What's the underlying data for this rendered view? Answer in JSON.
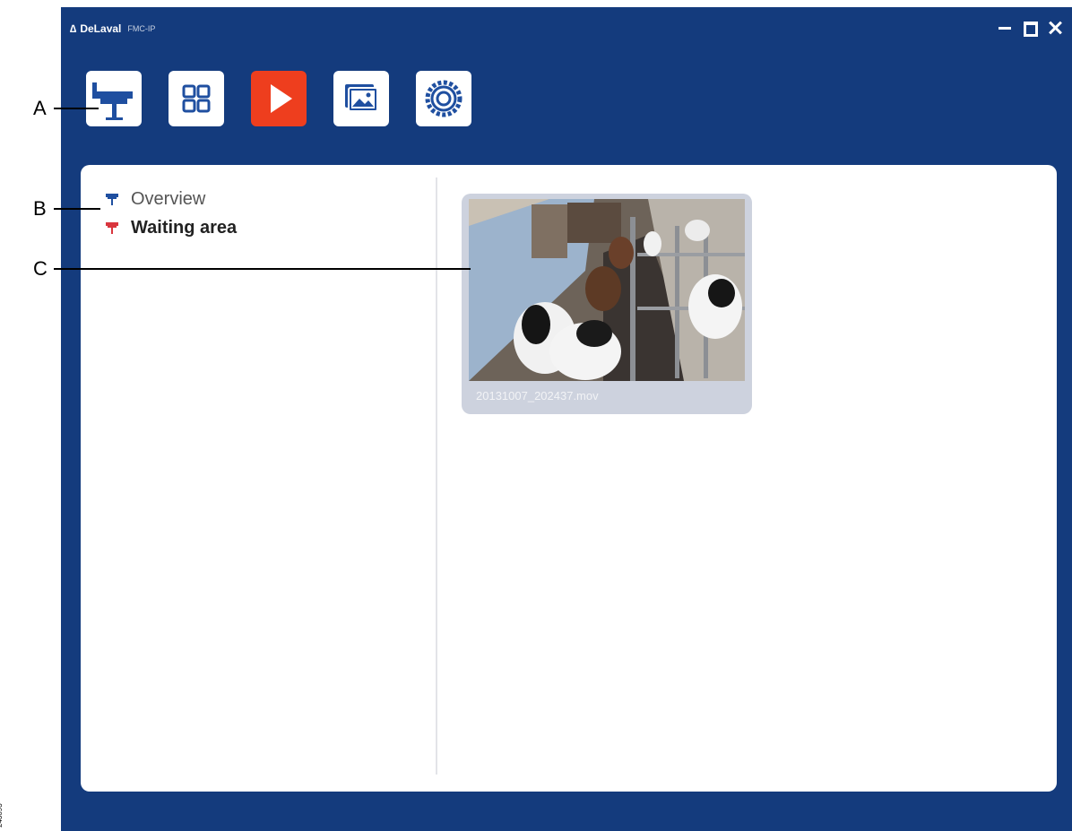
{
  "window": {
    "brand": "DeLaval",
    "product": "FMC-IP",
    "controls": [
      "minimize",
      "maximize",
      "close"
    ]
  },
  "toolbar": {
    "buttons": [
      {
        "icon": "camera-overview-icon",
        "active": false
      },
      {
        "icon": "grid-layout-icon",
        "active": false
      },
      {
        "icon": "play-icon",
        "active": true
      },
      {
        "icon": "gallery-icon",
        "active": false
      },
      {
        "icon": "settings-gear-icon",
        "active": false
      }
    ]
  },
  "sidebar": {
    "items": [
      {
        "label": "Overview",
        "icon": "camera-icon",
        "icon_color": "#1f4fa0",
        "selected": false
      },
      {
        "label": "Waiting area",
        "icon": "camera-icon",
        "icon_color": "#d9363e",
        "selected": true
      }
    ]
  },
  "recordings": [
    {
      "filename": "20131007_202437.mov"
    }
  ],
  "callouts": {
    "a": "A",
    "b": "B",
    "c": "C"
  },
  "doc_number": "243093",
  "colors": {
    "app_background": "#143b7d",
    "active_button": "#ee3e1e",
    "panel": "#ffffff"
  }
}
